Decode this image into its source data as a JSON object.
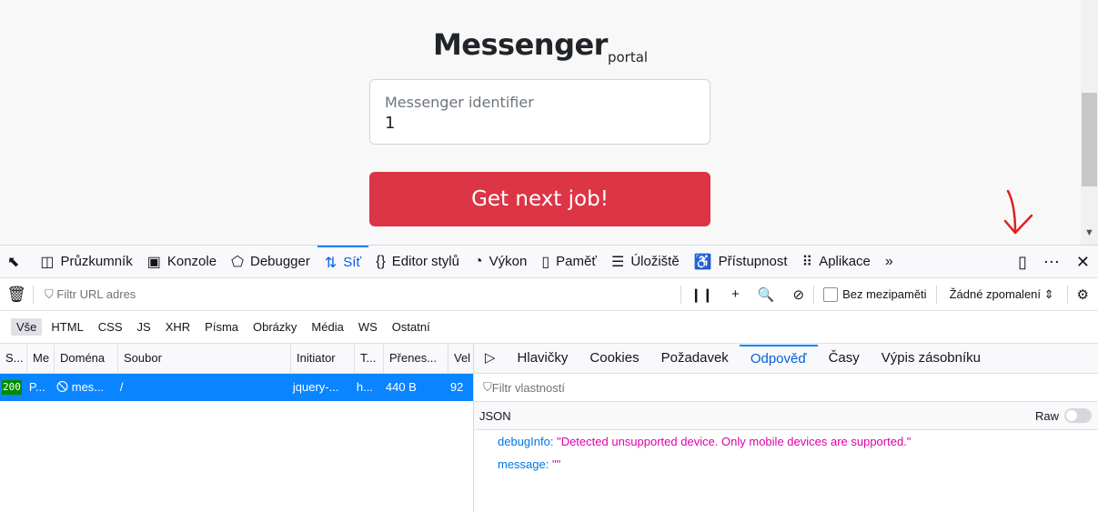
{
  "page": {
    "title": "Messenger",
    "subtitle": "portal",
    "id_field": {
      "label": "Messenger identifier",
      "value": "1"
    },
    "button_label": "Get next job!"
  },
  "devtools": {
    "tabs": [
      {
        "label": "Průzkumník",
        "icon": "inspector-icon"
      },
      {
        "label": "Konzole",
        "icon": "console-icon"
      },
      {
        "label": "Debugger",
        "icon": "debugger-icon"
      },
      {
        "label": "Síť",
        "icon": "network-icon",
        "active": true
      },
      {
        "label": "Editor stylů",
        "icon": "style-editor-icon"
      },
      {
        "label": "Výkon",
        "icon": "performance-icon"
      },
      {
        "label": "Paměť",
        "icon": "memory-icon"
      },
      {
        "label": "Úložiště",
        "icon": "storage-icon"
      },
      {
        "label": "Přístupnost",
        "icon": "accessibility-icon"
      },
      {
        "label": "Aplikace",
        "icon": "application-icon"
      }
    ],
    "filter_placeholder": "Filtr URL adres",
    "disable_cache_label": "Bez mezipaměti",
    "throttling_label": "Žádné zpomalení",
    "type_filters": [
      "Vše",
      "HTML",
      "CSS",
      "JS",
      "XHR",
      "Písma",
      "Obrázky",
      "Média",
      "WS",
      "Ostatní"
    ],
    "columns": [
      "S...",
      "Me",
      "Doména",
      "Soubor",
      "Initiator",
      "T...",
      "Přenes...",
      "Vel"
    ],
    "request_row": {
      "status": "200",
      "method": "P...",
      "domain": "mes...",
      "file": "/",
      "initiator": "jquery-...",
      "type": "h...",
      "transferred": "440 B",
      "size": "92"
    },
    "side_tabs": [
      "Hlavičky",
      "Cookies",
      "Požadavek",
      "Odpověď",
      "Časy",
      "Výpis zásobníku"
    ],
    "active_side_tab": "Odpověď",
    "property_filter_placeholder": "Filtr vlastností",
    "json_label": "JSON",
    "raw_label": "Raw",
    "response": [
      {
        "key": "debugInfo:",
        "value": "\"Detected unsupported device. Only mobile devices are supported.\""
      },
      {
        "key": "message:",
        "value": "\"\""
      }
    ]
  },
  "colors": {
    "accent": "#0a84ff",
    "danger_button": "#dc3545",
    "status_ok": "#058b00",
    "annotation_arrow": "#e02020"
  }
}
